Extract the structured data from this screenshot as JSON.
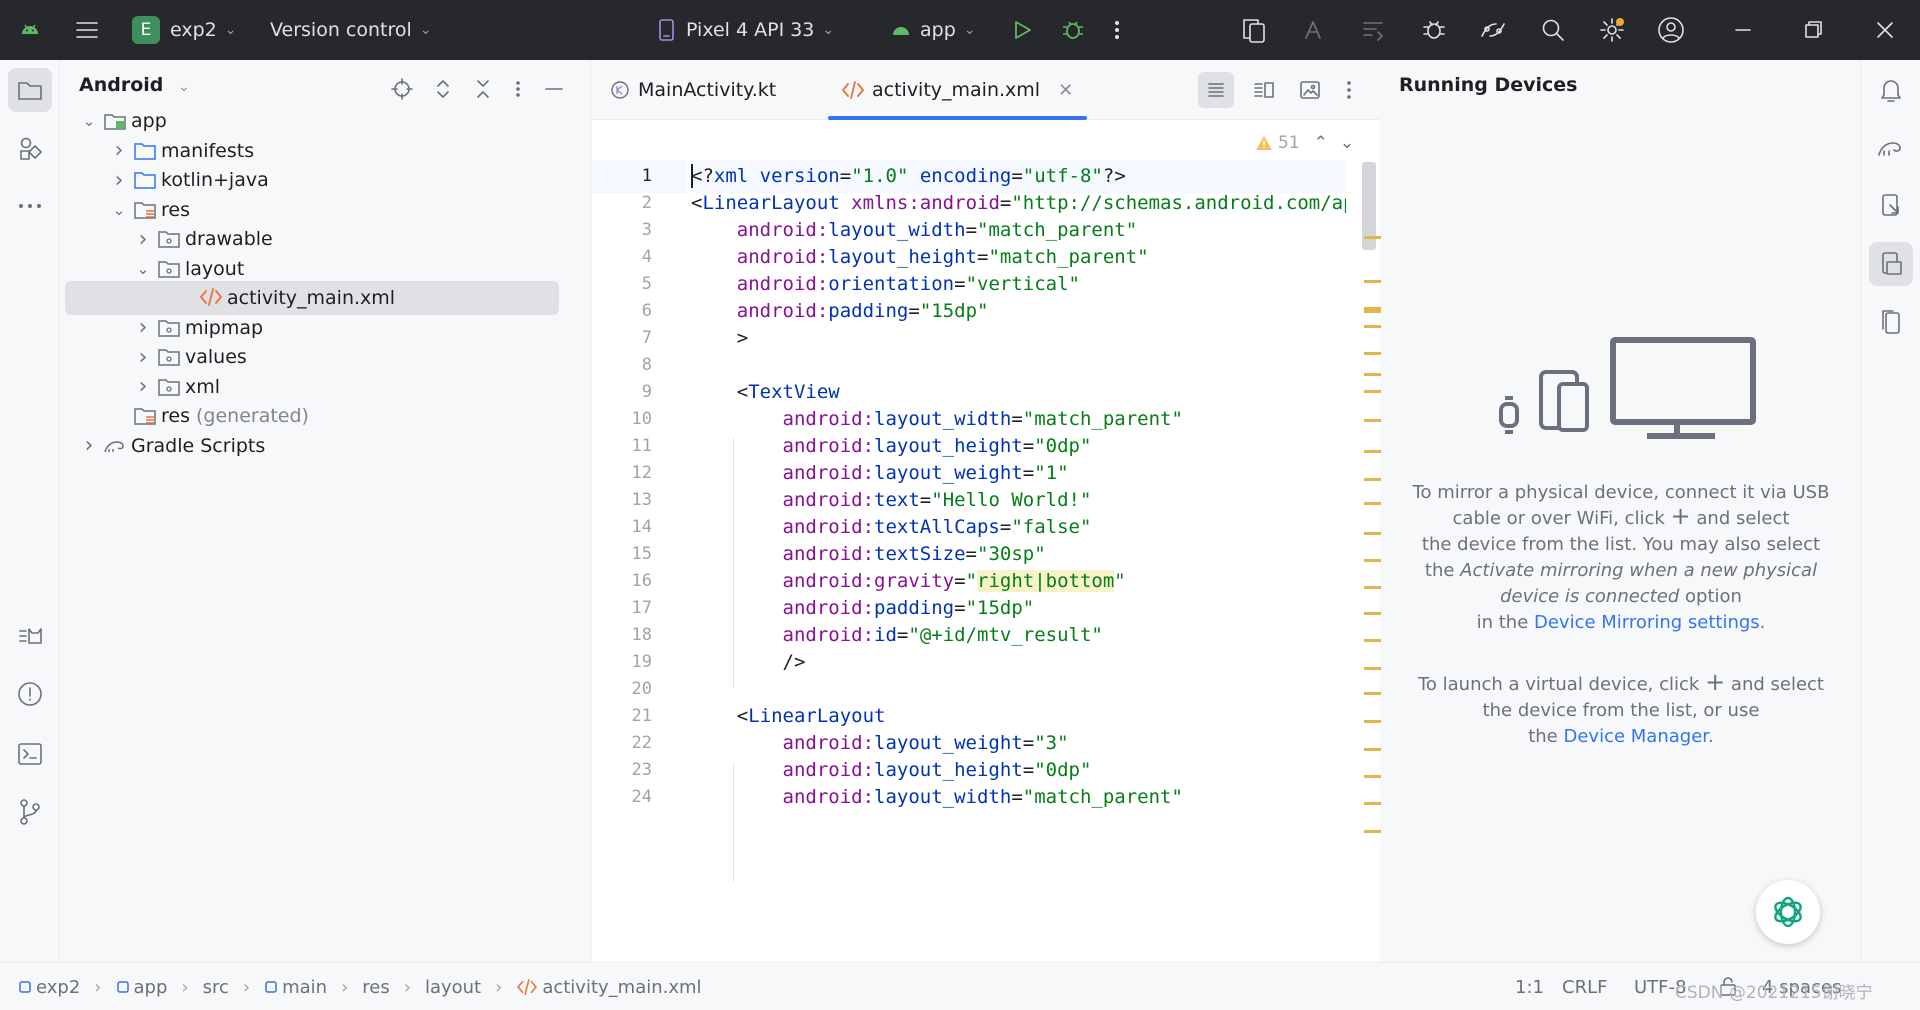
{
  "titlebar": {
    "project_initial": "E",
    "project_name": "exp2",
    "vcs": "Version control",
    "device": "Pixel 4 API 33",
    "run_config": "app",
    "colors": {
      "background": "#27282c",
      "run": "#5fb865",
      "debug": "#5fb865",
      "notify_dot": "#f0a732"
    }
  },
  "left_toolbar": {
    "icons": [
      "folder-icon",
      "resource-manager-icon",
      "more-icon",
      "logcat-icon",
      "problems-icon",
      "terminal-icon",
      "git-icon"
    ]
  },
  "project": {
    "view": "Android",
    "tree": [
      {
        "label": "app",
        "depth": 0,
        "expanded": true,
        "icon": "module-icon"
      },
      {
        "label": "manifests",
        "depth": 1,
        "expanded": false,
        "icon": "folder-icon"
      },
      {
        "label": "kotlin+java",
        "depth": 1,
        "expanded": false,
        "icon": "folder-icon"
      },
      {
        "label": "res",
        "depth": 1,
        "expanded": true,
        "icon": "res-folder-icon"
      },
      {
        "label": "drawable",
        "depth": 2,
        "expanded": false,
        "icon": "pkg-folder-icon"
      },
      {
        "label": "layout",
        "depth": 2,
        "expanded": true,
        "icon": "pkg-folder-icon"
      },
      {
        "label": "activity_main.xml",
        "depth": 3,
        "selected": true,
        "icon": "xml-file-icon"
      },
      {
        "label": "mipmap",
        "depth": 2,
        "expanded": false,
        "icon": "pkg-folder-icon"
      },
      {
        "label": "values",
        "depth": 2,
        "expanded": false,
        "icon": "pkg-folder-icon"
      },
      {
        "label": "xml",
        "depth": 2,
        "expanded": false,
        "icon": "pkg-folder-icon"
      },
      {
        "label": "res",
        "suffix": "(generated)",
        "depth": 1,
        "icon": "res-folder-icon"
      },
      {
        "label": "Gradle Scripts",
        "depth": 0,
        "expanded": false,
        "icon": "gradle-icon"
      }
    ]
  },
  "editor": {
    "tabs": [
      {
        "label": "MainActivity.kt",
        "active": false
      },
      {
        "label": "activity_main.xml",
        "active": true
      }
    ],
    "warnings": "51",
    "lines": [
      "1",
      "2",
      "3",
      "4",
      "5",
      "6",
      "7",
      "8",
      "9",
      "10",
      "11",
      "12",
      "13",
      "14",
      "15",
      "16",
      "17",
      "18",
      "19",
      "20",
      "21",
      "22",
      "23",
      "24"
    ],
    "code": {
      "l1": [
        "<?xml version=\"1.0\" encoding=\"utf-8\"?>"
      ],
      "l2": [
        "<LinearLayout",
        " xmlns:android",
        "=",
        "\"http://schemas.android.com/apk/res/android\""
      ],
      "l3": [
        "android:layout_width",
        "=",
        "\"match_parent\""
      ],
      "l4": [
        "android:layout_height",
        "=",
        "\"match_parent\""
      ],
      "l5": [
        "android:orientation",
        "=",
        "\"vertical\""
      ],
      "l6": [
        "android:padding",
        "=",
        "\"15dp\""
      ],
      "l7": [
        ">"
      ],
      "l9": [
        "<TextView"
      ],
      "l10": [
        "android:layout_width",
        "=",
        "\"match_parent\""
      ],
      "l11": [
        "android:layout_height",
        "=",
        "\"0dp\""
      ],
      "l12": [
        "android:layout_weight",
        "=",
        "\"1\""
      ],
      "l13": [
        "android:text",
        "=",
        "\"Hello World!\""
      ],
      "l14": [
        "android:textAllCaps",
        "=",
        "\"false\""
      ],
      "l15": [
        "android:textSize",
        "=",
        "\"30sp\""
      ],
      "l16": [
        "android:gravity",
        "=",
        "\"",
        "right|bottom",
        "\""
      ],
      "l17": [
        "android:padding",
        "=",
        "\"15dp\""
      ],
      "l18": [
        "android:id",
        "=",
        "\"@+id/mtv_result\""
      ],
      "l19": [
        "/>"
      ],
      "l21": [
        "<LinearLayout"
      ],
      "l22": [
        "android:layout_weight",
        "=",
        "\"3\""
      ],
      "l23": [
        "android:layout_height",
        "=",
        "\"0dp\""
      ],
      "l24": [
        "android:layout_width",
        "=",
        "\"match_parent\""
      ]
    },
    "colors": {
      "tag": "#0033b3",
      "attr": "#871094",
      "value": "#067d17",
      "highlight": "#f6f3c9"
    }
  },
  "devices": {
    "title": "Running Devices",
    "mirror": {
      "p1": "To mirror a physical device, connect it via USB",
      "p2a": "cable or over WiFi, click",
      "p2b": "and select",
      "p3": "the device from the list. You may also select",
      "p4a": "the",
      "p4em": "Activate mirroring when a new physical",
      "p5em": "device is connected",
      "p5b": "option",
      "p6a": "in the",
      "p6link": "Device Mirroring settings",
      "p6b": "."
    },
    "virtual": {
      "p1a": "To launch a virtual device, click",
      "p1b": "and select",
      "p2": "the device from the list, or use",
      "p3a": "the",
      "p3link": "Device Manager",
      "p3b": "."
    }
  },
  "statusbar": {
    "breadcrumb": [
      "exp2",
      "app",
      "src",
      "main",
      "res",
      "layout",
      "activity_main.xml"
    ],
    "position": "1:1",
    "line_sep": "CRLF",
    "encoding": "UTF-8",
    "indent": "4 spaces"
  },
  "watermark": "CSDN @2021215谢晓宁"
}
